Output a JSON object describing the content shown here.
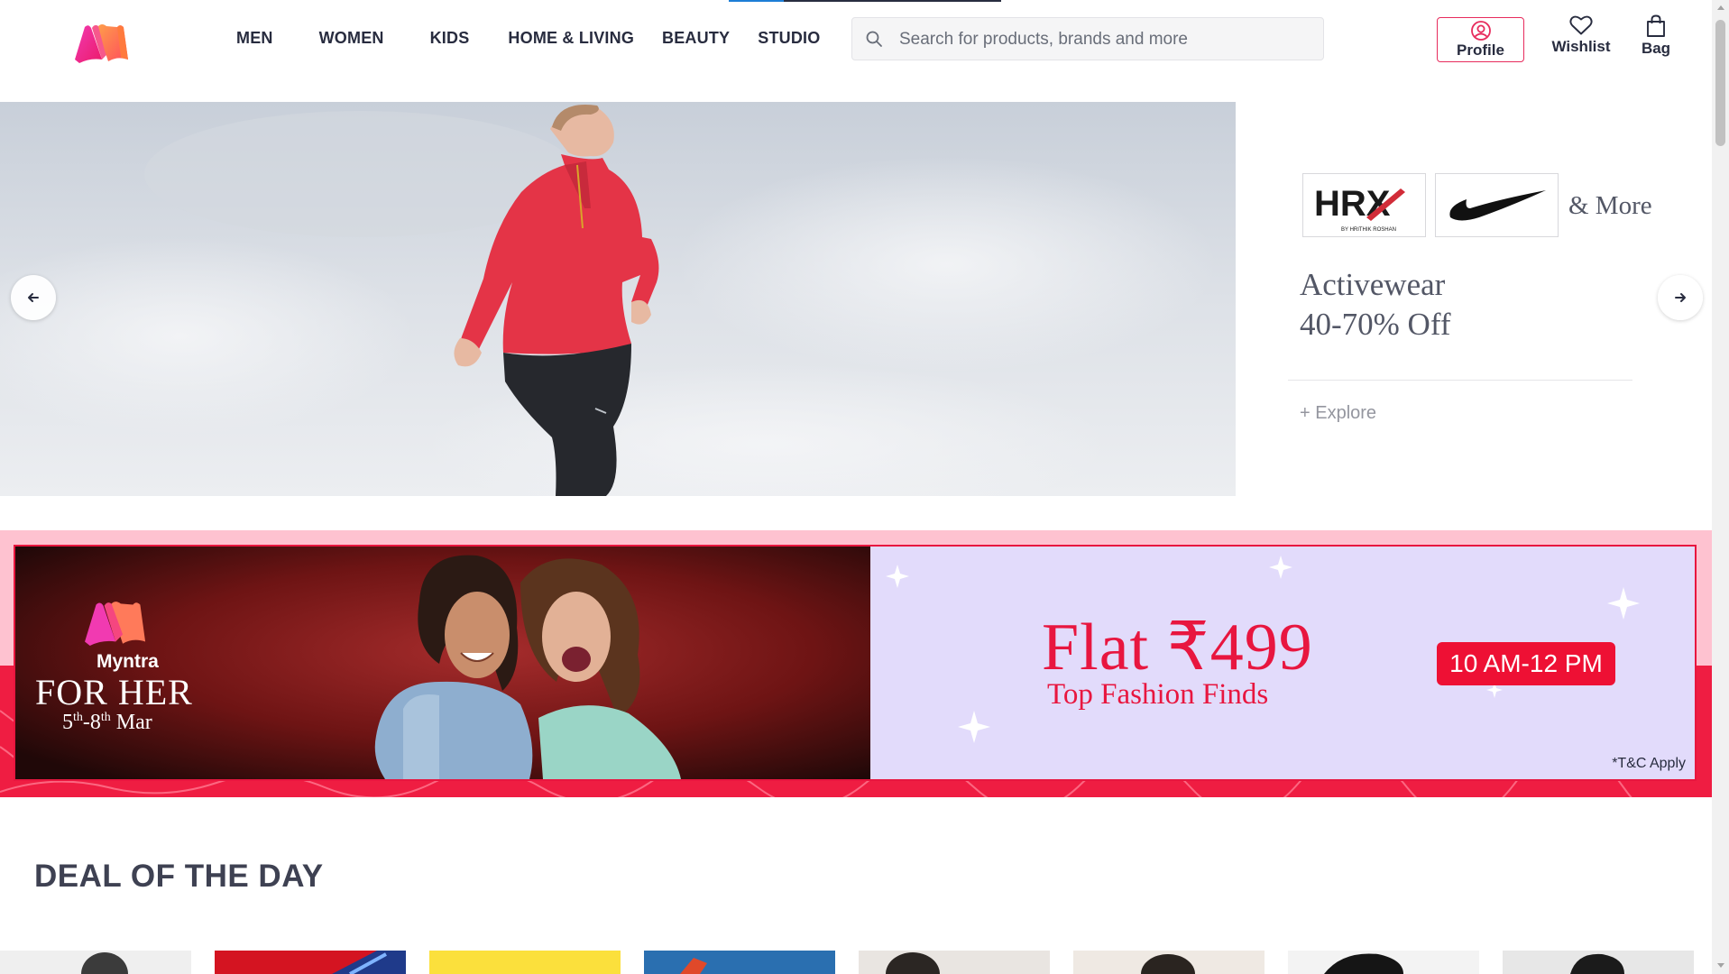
{
  "header": {
    "nav": [
      "MEN",
      "WOMEN",
      "KIDS",
      "HOME & LIVING",
      "BEAUTY",
      "STUDIO"
    ],
    "search_placeholder": "Search for products, brands and more",
    "profile_label": "Profile",
    "wishlist_label": "Wishlist",
    "bag_label": "Bag"
  },
  "hero": {
    "brands": [
      "HRX",
      "Nike"
    ],
    "hrx_tagline": "BY HRITHIK ROSHAN",
    "more_text": "& More",
    "title_line1": "Activewear",
    "title_line2": "40-70% Off",
    "explore_label": "+ Explore"
  },
  "promo": {
    "brand": "Myntra",
    "event": "FOR HER",
    "date_start": "5",
    "date_start_suffix": "th",
    "date_sep": "-",
    "date_end": "8",
    "date_end_suffix": "th",
    "date_month": " Mar",
    "offer": "Flat ₹499",
    "offer_sub": "Top Fashion Finds",
    "time": "10 AM-12 PM",
    "tc": "*T&C Apply"
  },
  "deal": {
    "title": "DEAL OF THE DAY"
  },
  "colors": {
    "brand_pink": "#ff3f6c",
    "brand_orange": "#ff905a",
    "promo_red": "#e8163f",
    "promo_lavender": "#e2dbfb",
    "text_dark": "#282c3f"
  }
}
